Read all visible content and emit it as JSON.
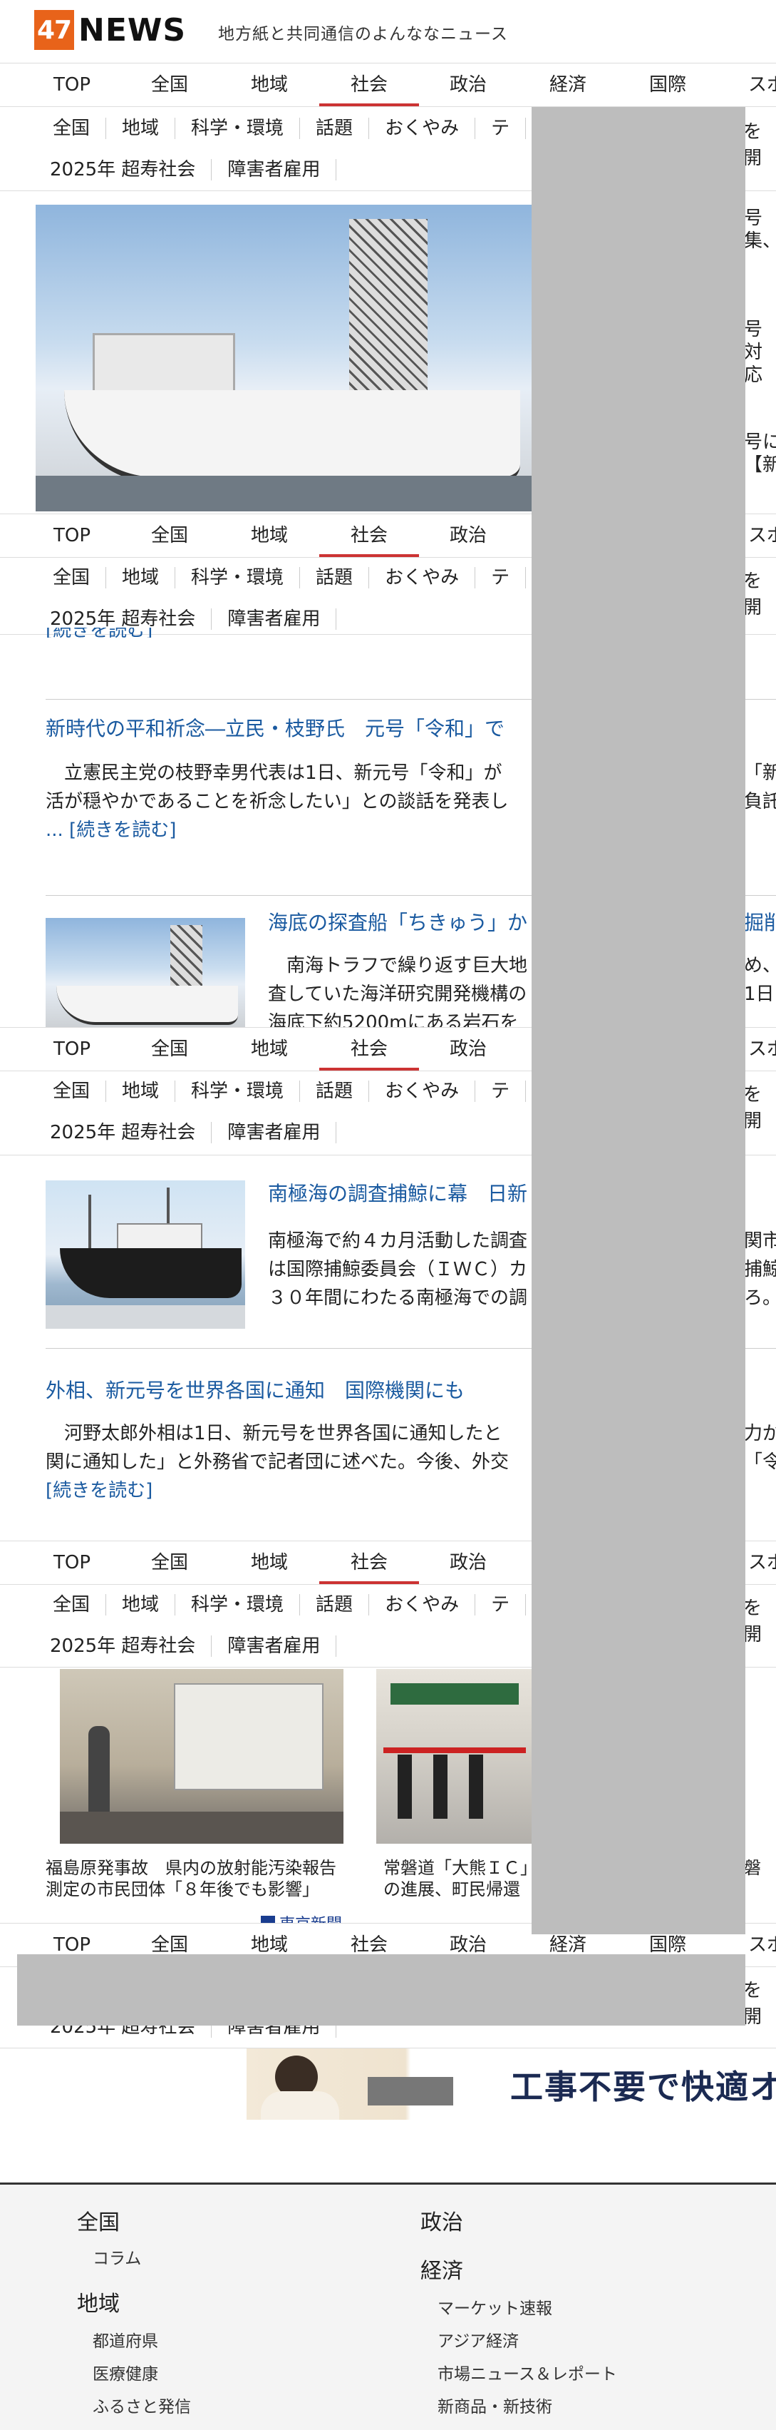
{
  "header": {
    "logo_number": "47",
    "logo_word": "NEWS",
    "tagline": "地方紙と共同通信のよんななニュース"
  },
  "nav": {
    "items": [
      "TOP",
      "全国",
      "地域",
      "社会",
      "政治",
      "経済",
      "国際",
      "スポ"
    ],
    "active": "社会"
  },
  "subnav": {
    "row1": [
      "全国",
      "地域",
      "科学・環境",
      "話題",
      "おくやみ",
      "テ"
    ],
    "row2": [
      "2025年 超寿社会",
      "障害者雇用"
    ],
    "right_fragment": "を開"
  },
  "side_fragments": {
    "f1a": "号",
    "f1b": "集、",
    "f2a": "号",
    "f2b": "対応",
    "f3a": "号に",
    "f3b": "【新"
  },
  "articles": {
    "a1": {
      "more": "[続きを読む]"
    },
    "a2": {
      "title": "新時代の平和祈念―立民・枝野氏　元号「令和」で",
      "body_line1": "立憲民主党の枝野幸男代表は1日、新元号「令和」が",
      "body_line2": "活が穏やかであることを祈念したい」との談話を発表し",
      "more": "... [続きを読む]",
      "right_frag1": "「新",
      "right_frag2": "負託"
    },
    "a3": {
      "title": "海底の探査船「ちきゅう」か",
      "title_right": "掘削",
      "body_line1": "南海トラフで繰り返す巨大地",
      "body_line2": "査していた海洋研究開発機構の",
      "body_line3": "海底下約5200mにある岩石を",
      "right_frag1": "め、",
      "right_frag2": "1日"
    },
    "a4": {
      "title": "南極海の調査捕鯨に幕　日新",
      "body_line1": "南極海で約４カ月活動した調査",
      "body_line2": "は国際捕鯨委員会（ＩＷＣ）カ",
      "body_line3": "３０年間にわたる南極海での調",
      "right_frag1": "関市",
      "right_frag2": "捕鯨",
      "right_frag3": "ろ。"
    },
    "a5": {
      "title": "外相、新元号を世界各国に通知　国際機関にも",
      "body_line1": "河野太郎外相は1日、新元号を世界各国に通知したと",
      "body_line2": "関に通知した」と外務省で記者団に述べた。今後、外交",
      "more": "[続きを読む]",
      "right_frag1": "力が",
      "right_frag2": "「令"
    }
  },
  "photos": [
    {
      "caption": "福島原発事故　県内の放射能汚染報告 測定の市民団体「８年後でも影響」",
      "source": "東京新聞"
    },
    {
      "caption": "常磐道「大熊ＩＣ」の進展、町民帰還",
      "right_frag": "磐道"
    }
  ],
  "ad": {
    "text": "工事不要で快適オ"
  },
  "footer": {
    "col1": {
      "head1": "全国",
      "link1": "コラム",
      "head2": "地域",
      "links": [
        "都道府県",
        "医療健康",
        "ふるさと発信"
      ]
    },
    "col2": {
      "head1": "政治",
      "head2": "経済",
      "links": [
        "マーケット速報",
        "アジア経済",
        "市場ニュース＆レポート",
        "新商品・新技術"
      ]
    }
  },
  "colors": {
    "brand": "#e8631a",
    "link": "#1a5aa0",
    "active_underline": "#c33",
    "overlay_gray": "#bdbdbd"
  }
}
